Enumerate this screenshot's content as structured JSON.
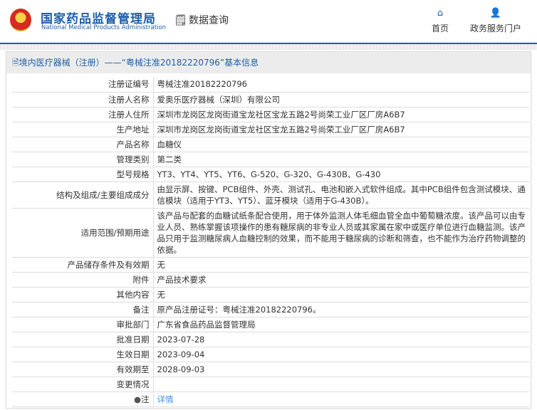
{
  "header": {
    "brand_cn": "国家药品监督管理局",
    "brand_en": "National Medical Products Administration",
    "query": "数据查询",
    "nav": [
      {
        "label": "首页",
        "icon": "home-icon"
      },
      {
        "label": "政务服务门户",
        "icon": "user-icon"
      }
    ]
  },
  "panel": {
    "title": "境内医疗器械（注册）——“粤械注准20182220796”基本信息"
  },
  "rows": [
    {
      "label": "注册证编号",
      "value": "粤械注准20182220796"
    },
    {
      "label": "注册人名称",
      "value": "爱奥乐医疗器械（深圳）有限公司"
    },
    {
      "label": "注册人住所",
      "value": "深圳市龙岗区龙岗街道宝龙社区宝龙五路2号尚荣工业厂区厂房A6B7"
    },
    {
      "label": "生产地址",
      "value": "深圳市龙岗区龙岗街道宝龙社区宝龙五路2号尚荣工业厂区厂房A6B7"
    },
    {
      "label": "产品名称",
      "value": "血糖仪"
    },
    {
      "label": "管理类别",
      "value": "第二类"
    },
    {
      "label": "型号规格",
      "value": "YT3、YT4、YT5、YT6、G-520、G-320、G-430B、G-430"
    },
    {
      "label": "结构及组成/主要组成成分",
      "value": "由显示屏、按键、PCB组件、外壳、测试孔、电池和嵌入式软件组成。其中PCB组件包含测试模块、通信模块（适用于YT3、YT5）、蓝牙模块（适用于G-430B）。"
    },
    {
      "label": "适用范围/预期用途",
      "value": "该产品与配套的血糖试纸条配合使用，用于体外监测人体毛细血管全血中葡萄糖浓度。该产品可以由专业人员、熟练掌握该项操作的患有糖尿病的非专业人员或其家属在家中或医疗单位进行血糖监测。该产品只用于监测糖尿病人血糖控制的效果，而不能用于糖尿病的诊断和筛查，也不能作为治疗药物调整的依据。"
    },
    {
      "label": "产品储存条件及有效期",
      "value": "无"
    },
    {
      "label": "附件",
      "value": "产品技术要求"
    },
    {
      "label": "其他内容",
      "value": "无"
    },
    {
      "label": "备注",
      "value": "原产品注册证号：粤械注准20182220796。"
    },
    {
      "label": "审批部门",
      "value": "广东省食品药品监督管理局"
    },
    {
      "label": "批准日期",
      "value": "2023-07-28"
    },
    {
      "label": "生效日期",
      "value": "2023-09-04"
    },
    {
      "label": "有效期至",
      "value": "2028-09-03"
    },
    {
      "label": "变更情况",
      "value": ""
    }
  ],
  "note": {
    "label": "注",
    "link": "详情"
  }
}
